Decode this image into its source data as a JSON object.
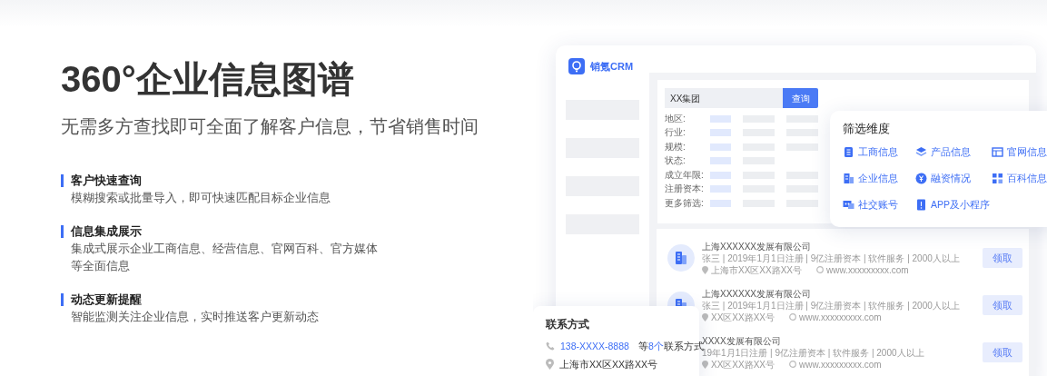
{
  "hero": {
    "title": "360°企业信息图谱",
    "subtitle": "无需多方查找即可全面了解客户信息，节省销售时间"
  },
  "features": [
    {
      "title": "客户快速查询",
      "description": "模糊搜索或批量导入，即可快速匹配目标企业信息"
    },
    {
      "title": "信息集成展示",
      "description": "集成式展示企业工商信息、经营信息、官网百科、官方媒体等全面信息"
    },
    {
      "title": "动态更新提醒",
      "description": "智能监测关注企业信息，实时推送客户更新动态"
    }
  ],
  "mockup": {
    "brand": "销氪CRM",
    "search": {
      "value": "XX集团",
      "button": "查询"
    },
    "filters": [
      {
        "label": "地区:",
        "kind": "full"
      },
      {
        "label": "行业:",
        "kind": "full"
      },
      {
        "label": "规模:",
        "kind": "full"
      },
      {
        "label": "状态:",
        "kind": "short"
      },
      {
        "label": "成立年限:",
        "kind": "full"
      },
      {
        "label": "注册资本:",
        "kind": "full"
      },
      {
        "label": "更多筛选:",
        "kind": "full"
      }
    ],
    "companies": [
      {
        "name": "上海XXXXXX发展有限公司",
        "details": "张三 | 2019年1月1日注册 | 9亿注册资本 | 软件服务 | 2000人以上",
        "address": "上海市XX区XX路XX号",
        "website": "www.xxxxxxxxx.com",
        "action": "领取"
      },
      {
        "name": "上海XXXXXX发展有限公司",
        "details": "张三 | 2019年1月1日注册 | 9亿注册资本 | 软件服务 | 2000人以上",
        "address": "XX区XX路XX号",
        "website": "www.xxxxxxxxx.com",
        "action": "领取"
      },
      {
        "name": "XXXX发展有限公司",
        "details": "19年1月1日注册 | 9亿注册资本 | 软件服务 | 2000人以上",
        "address": "XX区XX路XX号",
        "website": "www.xxxxxxxxx.com",
        "action": "领取"
      }
    ]
  },
  "filter_card": {
    "title": "筛选维度",
    "items": [
      "工商信息",
      "产品信息",
      "官网信息",
      "企业信息",
      "融资情况",
      "百科信息",
      "社交账号",
      "APP及小程序"
    ]
  },
  "contact_card": {
    "title": "联系方式",
    "phone": "138-XXXX-8888",
    "more": [
      {
        "text": "等",
        "highlight": false
      },
      {
        "text": "8个",
        "highlight": true
      },
      {
        "text": "联系方式",
        "highlight": false
      }
    ],
    "address": "上海市XX区XX路XX号"
  }
}
